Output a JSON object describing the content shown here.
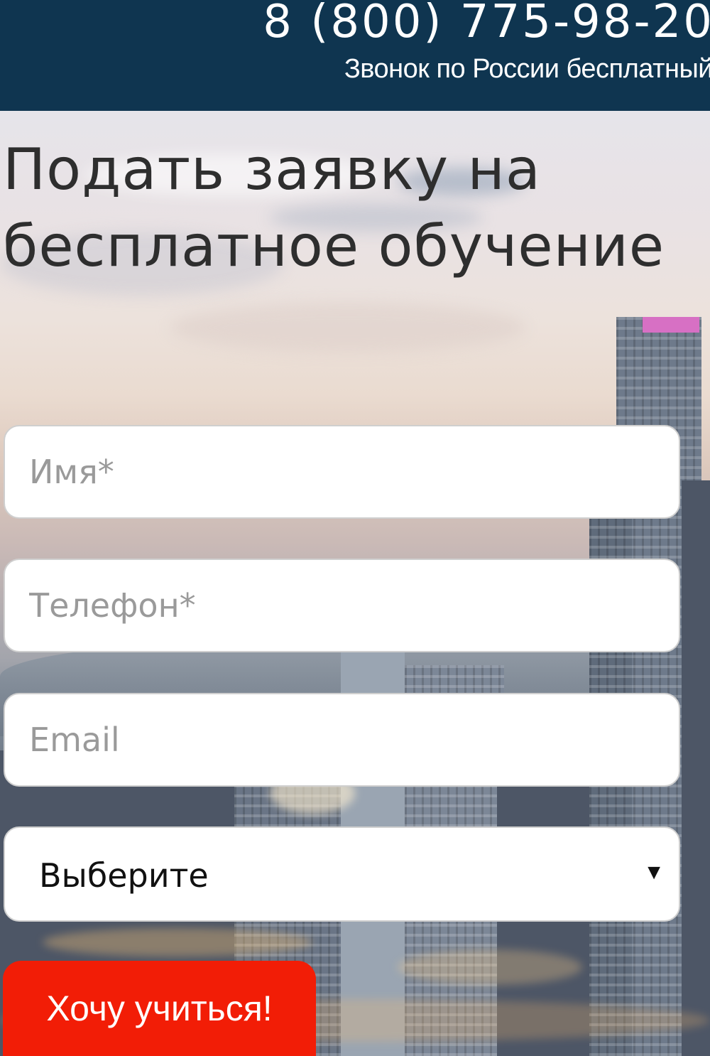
{
  "header": {
    "phone": "8 (800) 775-98-20",
    "phone_note": "Звонок по России бесплатный"
  },
  "form": {
    "title": "Подать заявку на бесплатное обучение",
    "name_placeholder": "Имя*",
    "phone_placeholder": "Телефон*",
    "email_placeholder": "Email",
    "select_value": "Выберите",
    "submit_label": "Хочу учиться!"
  },
  "colors": {
    "header_bg": "#0f3550",
    "submit_bg": "#f21d06"
  },
  "icons": {
    "select_arrow": "caret-down-icon"
  }
}
